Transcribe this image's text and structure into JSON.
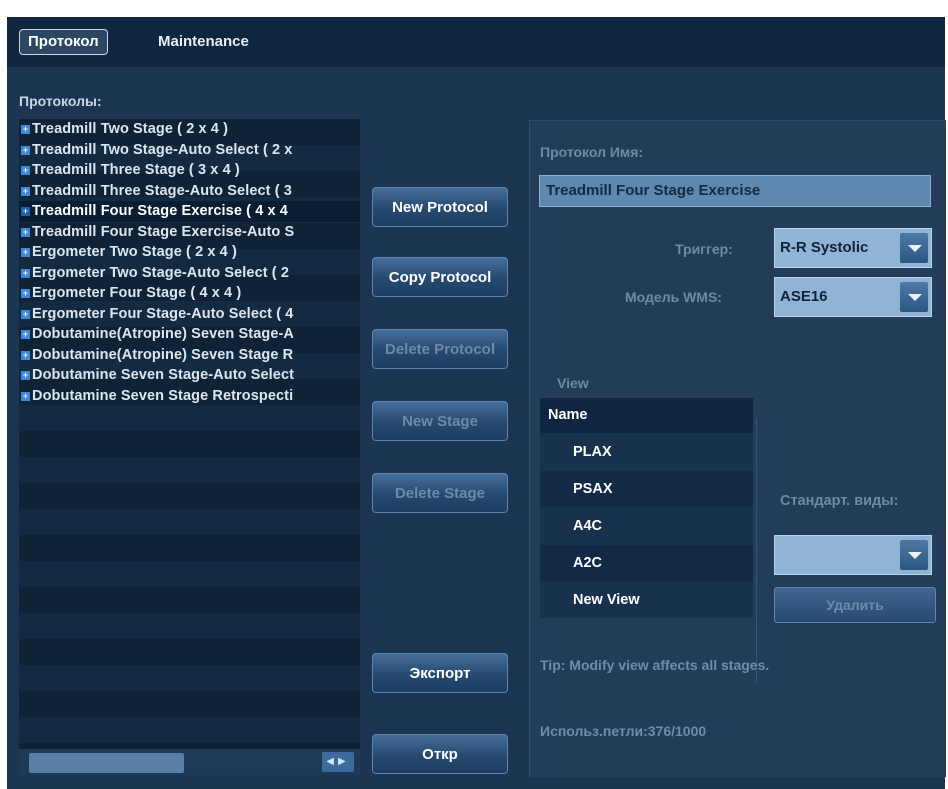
{
  "tabs": [
    {
      "label": "Протокол",
      "active": true
    },
    {
      "label": "Maintenance",
      "active": false
    }
  ],
  "protocols_label": "Протоколы:",
  "protocols": [
    {
      "label": "Treadmill Two Stage ( 2 x 4 )",
      "selected": false
    },
    {
      "label": "Treadmill Two Stage-Auto Select ( 2 x",
      "selected": false
    },
    {
      "label": "Treadmill Three Stage ( 3 x 4 )",
      "selected": false
    },
    {
      "label": "Treadmill Three Stage-Auto Select ( 3",
      "selected": false
    },
    {
      "label": "Treadmill Four Stage Exercise ( 4 x 4",
      "selected": true
    },
    {
      "label": "Treadmill Four Stage Exercise-Auto S",
      "selected": false
    },
    {
      "label": "Ergometer Two Stage ( 2 x 4 )",
      "selected": false
    },
    {
      "label": "Ergometer Two Stage-Auto Select ( 2",
      "selected": false
    },
    {
      "label": "Ergometer Four Stage ( 4 x 4 )",
      "selected": false
    },
    {
      "label": "Ergometer Four Stage-Auto Select ( 4",
      "selected": false
    },
    {
      "label": "Dobutamine(Atropine) Seven Stage-A",
      "selected": false
    },
    {
      "label": "Dobutamine(Atropine) Seven Stage R",
      "selected": false
    },
    {
      "label": "Dobutamine Seven Stage-Auto Select",
      "selected": false
    },
    {
      "label": "Dobutamine Seven Stage Retrospecti",
      "selected": false
    }
  ],
  "buttons": {
    "new_protocol": "New Protocol",
    "copy_protocol": "Copy Protocol",
    "delete_protocol": "Delete Protocol",
    "new_stage": "New Stage",
    "delete_stage": "Delete Stage",
    "export": "Экспорт",
    "open": "Откр"
  },
  "protocol_name_label": "Протокол Имя:",
  "protocol_name_value": "Treadmill Four Stage Exercise",
  "trigger_label": "Триггер:",
  "trigger_value": "R-R Systolic",
  "wms_label": "Модель WMS:",
  "wms_value": "ASE16",
  "view_label": "View",
  "view_table_header": "Name",
  "views": [
    "PLAX",
    "PSAX",
    "A4C",
    "A2C",
    "New View"
  ],
  "standard_views_label": "Стандарт. виды:",
  "standard_views_value": "",
  "delete_button": "Удалить",
  "tip": "Tip: Modify view affects all stages.",
  "loops": "Использ.петли:376/1000",
  "icons": {
    "expand": "plus-box-icon",
    "dropdown": "chevron-down-icon",
    "scroll_left": "arrow-left-icon",
    "scroll_right": "arrow-right-icon"
  },
  "colors": {
    "background": "#1b3553",
    "tabbar": "#0f2640",
    "selection": "#0a1e33",
    "accent": "#3d8ad6",
    "disabled_text": "#6e8aa8"
  }
}
